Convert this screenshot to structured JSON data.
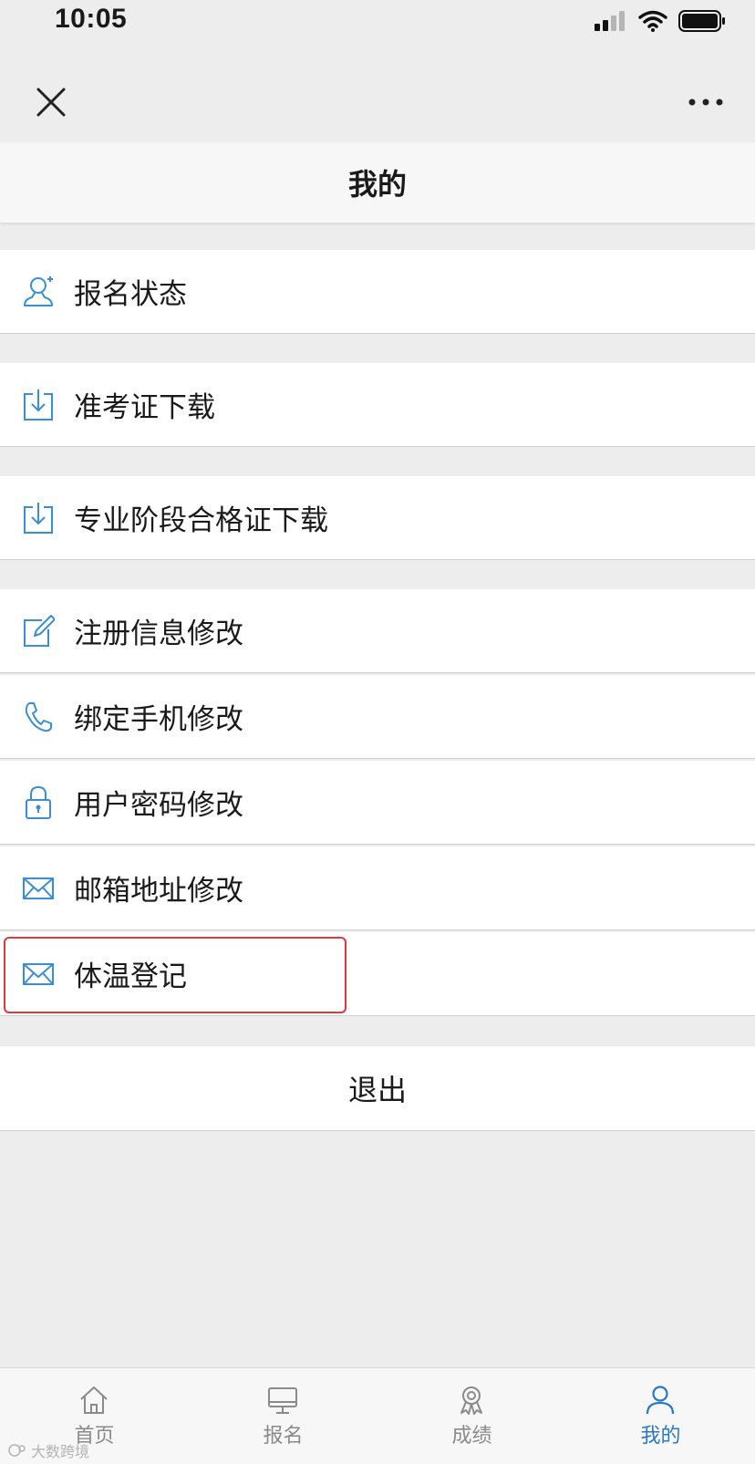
{
  "status_bar": {
    "time": "10:05"
  },
  "page": {
    "title": "我的"
  },
  "menu": {
    "items": [
      {
        "label": "报名状态",
        "icon": "user-icon"
      },
      {
        "label": "准考证下载",
        "icon": "download-icon"
      },
      {
        "label": "专业阶段合格证下载",
        "icon": "download-icon"
      },
      {
        "label": "注册信息修改",
        "icon": "edit-icon"
      },
      {
        "label": "绑定手机修改",
        "icon": "phone-icon"
      },
      {
        "label": "用户密码修改",
        "icon": "lock-icon"
      },
      {
        "label": "邮箱地址修改",
        "icon": "mail-icon"
      },
      {
        "label": "体温登记",
        "icon": "mail-icon"
      }
    ],
    "logout_label": "退出"
  },
  "tab_bar": {
    "tabs": [
      {
        "label": "首页",
        "icon": "home-icon"
      },
      {
        "label": "报名",
        "icon": "monitor-icon"
      },
      {
        "label": "成绩",
        "icon": "award-icon"
      },
      {
        "label": "我的",
        "icon": "person-icon",
        "active": true
      }
    ]
  },
  "colors": {
    "accent": "#2a78c3",
    "icon_blue": "#3a8fd4",
    "highlight": "#e0393b",
    "background": "#ededed"
  },
  "watermark": {
    "text": "大数跨境"
  }
}
